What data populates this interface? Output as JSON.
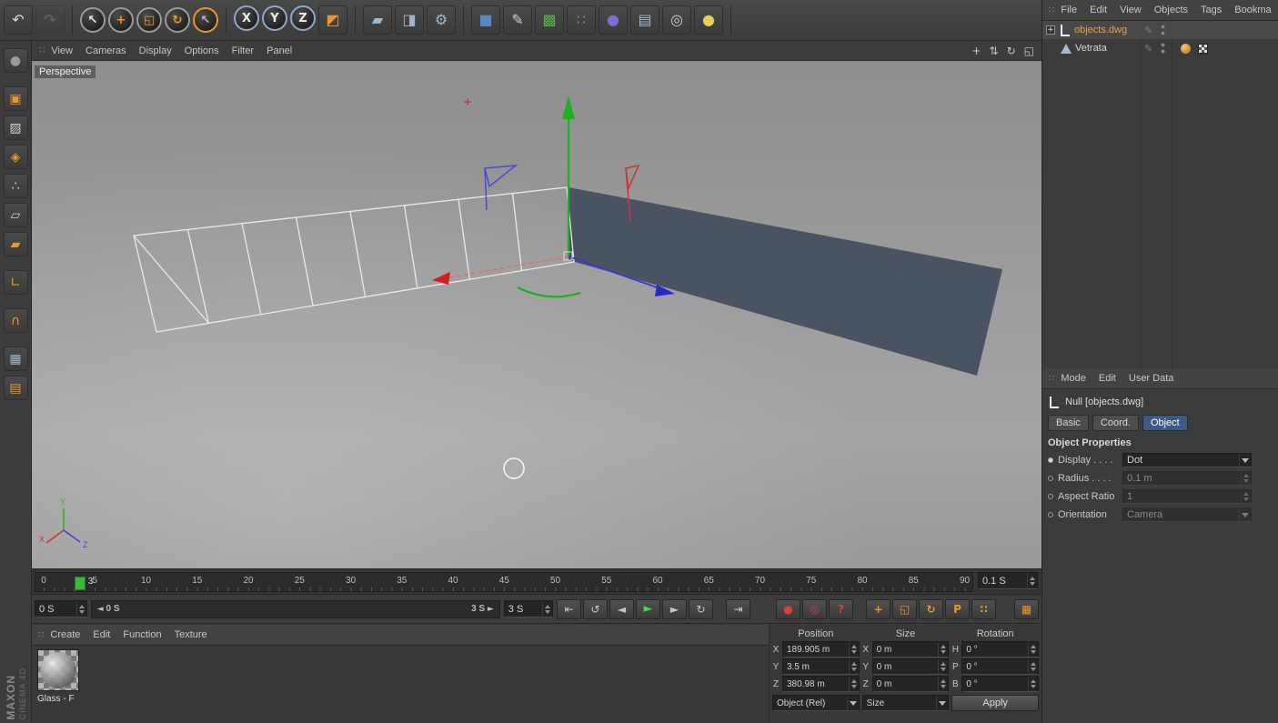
{
  "icons": {
    "grip": "∷",
    "expander": "+",
    "pencil": "✎",
    "scrub_left_pointer": "◄",
    "scrub_right_pointer": "►"
  },
  "top_toolbar": {
    "groups": [
      [
        {
          "name": "undo",
          "glyph": "↶",
          "fg": "#d8d8d8"
        },
        {
          "name": "redo",
          "glyph": "↷",
          "fg": "#9a9a9a",
          "disabled": true
        }
      ],
      [
        {
          "name": "live-selection",
          "glyph": "↖",
          "fg": "#ececec",
          "shape": "circle",
          "ring": "#9a9a9a"
        },
        {
          "name": "move-tool",
          "glyph": "+",
          "fg": "#e8962f",
          "shape": "circle",
          "ring": "#9a9a9a"
        },
        {
          "name": "scale-tool",
          "glyph": "◱",
          "fg": "#e8962f",
          "shape": "circle",
          "ring": "#9a9a9a"
        },
        {
          "name": "rotate-tool",
          "glyph": "↻",
          "fg": "#e8962f",
          "shape": "circle",
          "ring": "#9a9a9a"
        },
        {
          "name": "last-tool",
          "glyph": "↖",
          "fg": "#b8b8b8",
          "shape": "circle",
          "ring": "#e8962f"
        }
      ],
      [
        {
          "name": "lock-x-axis",
          "glyph": "X",
          "fg": "#ececec",
          "shape": "circle",
          "ring": "#8fa8c8"
        },
        {
          "name": "lock-y-axis",
          "glyph": "Y",
          "fg": "#ececec",
          "shape": "circle",
          "ring": "#8fa8c8"
        },
        {
          "name": "lock-z-axis",
          "glyph": "Z",
          "fg": "#ececec",
          "shape": "circle",
          "ring": "#8fa8c8"
        },
        {
          "name": "coordinate-system",
          "glyph": "◩",
          "fg": "#e8962f"
        }
      ],
      [
        {
          "name": "render-view",
          "glyph": "▰",
          "fg": "#9fb6c8"
        },
        {
          "name": "render-picture-viewer",
          "glyph": "◨",
          "fg": "#9fb6c8"
        },
        {
          "name": "render-settings",
          "glyph": "⚙",
          "fg": "#9fb6c8"
        }
      ],
      [
        {
          "name": "add-cube",
          "glyph": "■",
          "fg": "#5b87c5"
        },
        {
          "name": "add-spline",
          "glyph": "✎",
          "fg": "#cfcfcf"
        },
        {
          "name": "add-subdivision-surface",
          "glyph": "▩",
          "fg": "#58b04a"
        },
        {
          "name": "add-generator",
          "glyph": "∷",
          "fg": "#58b04a"
        },
        {
          "name": "add-deformer",
          "glyph": "●",
          "fg": "#7a6fd0"
        },
        {
          "name": "add-environment",
          "glyph": "▤",
          "fg": "#9fb6c8"
        },
        {
          "name": "add-camera",
          "glyph": "◎",
          "fg": "#cfcfcf"
        },
        {
          "name": "add-light",
          "glyph": "●",
          "fg": "#e6cf5a"
        }
      ]
    ]
  },
  "left_toolbar": {
    "groups": [
      [
        {
          "name": "make-editable",
          "glyph": "●",
          "fg": "#9a9a9a"
        }
      ],
      [
        {
          "name": "model-mode",
          "glyph": "▣",
          "fg": "#e8962f"
        },
        {
          "name": "texture-mode",
          "glyph": "▨",
          "fg": "#cfcfcf"
        },
        {
          "name": "workplane-mode",
          "glyph": "◈",
          "fg": "#e8962f"
        },
        {
          "name": "points-mode",
          "glyph": "∴",
          "fg": "#cfcfcf"
        },
        {
          "name": "edges-mode",
          "glyph": "▱",
          "fg": "#cfcfcf"
        },
        {
          "name": "polygons-mode",
          "glyph": "▰",
          "fg": "#e8962f"
        }
      ],
      [
        {
          "name": "enable-axis",
          "glyph": "∟",
          "fg": "#e8962f"
        }
      ],
      [
        {
          "name": "enable-snap",
          "glyph": "∩",
          "fg": "#e8962f"
        }
      ],
      [
        {
          "name": "workplane-lock",
          "glyph": "▦",
          "fg": "#9fb6c8"
        },
        {
          "name": "planar-workplane",
          "glyph": "▤",
          "fg": "#e8962f"
        }
      ]
    ]
  },
  "viewport": {
    "menu": [
      "View",
      "Cameras",
      "Display",
      "Options",
      "Filter",
      "Panel"
    ],
    "label": "Perspective",
    "nav_icons": [
      {
        "name": "pan-view",
        "glyph": "+"
      },
      {
        "name": "zoom-view",
        "glyph": "⇅"
      },
      {
        "name": "rotate-view",
        "glyph": "↻"
      },
      {
        "name": "toggle-view",
        "glyph": "◱"
      }
    ],
    "triad": {
      "x": "X",
      "y": "Y",
      "z": "Z"
    }
  },
  "object_manager": {
    "menu": [
      "File",
      "Edit",
      "View",
      "Objects",
      "Tags",
      "Bookmarks"
    ],
    "rows": [
      {
        "name": "objects.dwg",
        "selected": true,
        "level": 0,
        "icon": "null",
        "expander": true,
        "tags": []
      },
      {
        "name": "Vetrata",
        "selected": false,
        "level": 1,
        "icon": "polygon",
        "expander": false,
        "tags": [
          "phong",
          "texture"
        ]
      }
    ]
  },
  "attributes": {
    "menu": [
      "Mode",
      "Edit",
      "User Data"
    ],
    "title": "Null [objects.dwg]",
    "tabs": [
      {
        "label": "Basic",
        "active": false
      },
      {
        "label": "Coord.",
        "active": false
      },
      {
        "label": "Object",
        "active": true
      }
    ],
    "section": "Object Properties",
    "fields": [
      {
        "label": "Display . . . .",
        "value": "Dot",
        "control": "dropdown",
        "enabled": true,
        "dot": "filled"
      },
      {
        "label": "Radius . . . .",
        "value": "0.1 m",
        "control": "number",
        "enabled": false,
        "dot": "empty"
      },
      {
        "label": "Aspect Ratio",
        "value": "1",
        "control": "number",
        "enabled": false,
        "dot": "empty"
      },
      {
        "label": "Orientation",
        "value": "Camera",
        "control": "dropdown",
        "enabled": false,
        "dot": "empty"
      }
    ]
  },
  "timeline": {
    "tick_labels": [
      0,
      5,
      10,
      15,
      20,
      25,
      30,
      35,
      40,
      45,
      50,
      55,
      60,
      65,
      70,
      75,
      80,
      85,
      90
    ],
    "marker_frame": 3,
    "marker_label": "3",
    "time_field": "0.1 S"
  },
  "animation": {
    "range_start": "0 S",
    "range_end": "3 S",
    "scrub_start": "0 S",
    "scrub_end": "3 S",
    "transport": [
      {
        "name": "goto-start-button",
        "glyph": "⇤"
      },
      {
        "name": "play-reverse-button",
        "glyph": "↺"
      },
      {
        "name": "previous-frame-button",
        "glyph": "◄"
      },
      {
        "name": "play-button",
        "glyph": "►",
        "accent": true
      },
      {
        "name": "next-frame-button",
        "glyph": "►"
      },
      {
        "name": "play-cycle-button",
        "glyph": "↻"
      }
    ],
    "goto_end": [
      {
        "name": "goto-end-button",
        "glyph": "⇥"
      }
    ],
    "record_buttons": [
      {
        "name": "record-keyframe-button",
        "glyph": "●"
      },
      {
        "name": "autokey-button",
        "glyph": "◎"
      },
      {
        "name": "keyframe-mode-button",
        "glyph": "?"
      }
    ],
    "key_toggles": [
      {
        "name": "key-position-toggle",
        "glyph": "+"
      },
      {
        "name": "key-scale-toggle",
        "glyph": "◱"
      },
      {
        "name": "key-rotation-toggle",
        "glyph": "↻"
      },
      {
        "name": "key-parameter-toggle",
        "glyph": "P"
      },
      {
        "name": "key-pla-toggle",
        "glyph": "∷"
      }
    ],
    "extra_buttons": [
      {
        "name": "keying-settings-button",
        "glyph": "▦"
      }
    ]
  },
  "materials": {
    "menu": [
      "Create",
      "Edit",
      "Function",
      "Texture"
    ],
    "items": [
      {
        "label": "Glass - F"
      }
    ]
  },
  "coordinates": {
    "columns": [
      {
        "header": "Position",
        "rows": [
          [
            "X",
            "189.905 m"
          ],
          [
            "Y",
            "3.5 m"
          ],
          [
            "Z",
            "380.98 m"
          ]
        ],
        "footer": "Object (Rel)",
        "footer_type": "dropdown"
      },
      {
        "header": "Size",
        "rows": [
          [
            "X",
            "0 m"
          ],
          [
            "Y",
            "0 m"
          ],
          [
            "Z",
            "0 m"
          ]
        ],
        "footer": "Size",
        "footer_type": "dropdown"
      },
      {
        "header": "Rotation",
        "rows": [
          [
            "H",
            "0 °"
          ],
          [
            "P",
            "0 °"
          ],
          [
            "B",
            "0 °"
          ]
        ],
        "footer": "Apply",
        "footer_type": "button"
      }
    ]
  },
  "brand": {
    "line1": "MAXON",
    "line2": "CINEMA 4D"
  }
}
